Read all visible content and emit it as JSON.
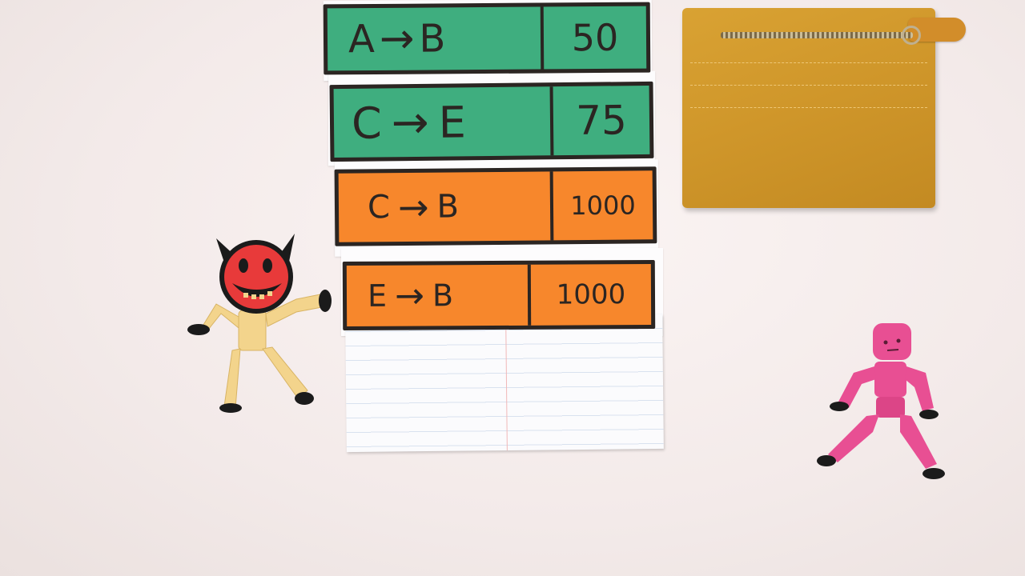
{
  "transactions": [
    {
      "from": "A",
      "to": "B",
      "arrow": "→",
      "amount": "50",
      "color": "#3fae7f"
    },
    {
      "from": "C",
      "to": "E",
      "arrow": "→",
      "amount": "75",
      "color": "#3fae7f"
    },
    {
      "from": "C",
      "to": "B",
      "arrow": "→",
      "amount": "1000",
      "color": "#f7872c"
    },
    {
      "from": "E",
      "to": "B",
      "arrow": "→",
      "amount": "1000",
      "color": "#f7872c"
    }
  ],
  "objects": {
    "wallet": {
      "color": "#cf962a"
    },
    "devil_figure": {
      "head_color": "#e83a3a",
      "body_color": "#f3d48c"
    },
    "pink_figure": {
      "color": "#e84f93"
    }
  }
}
